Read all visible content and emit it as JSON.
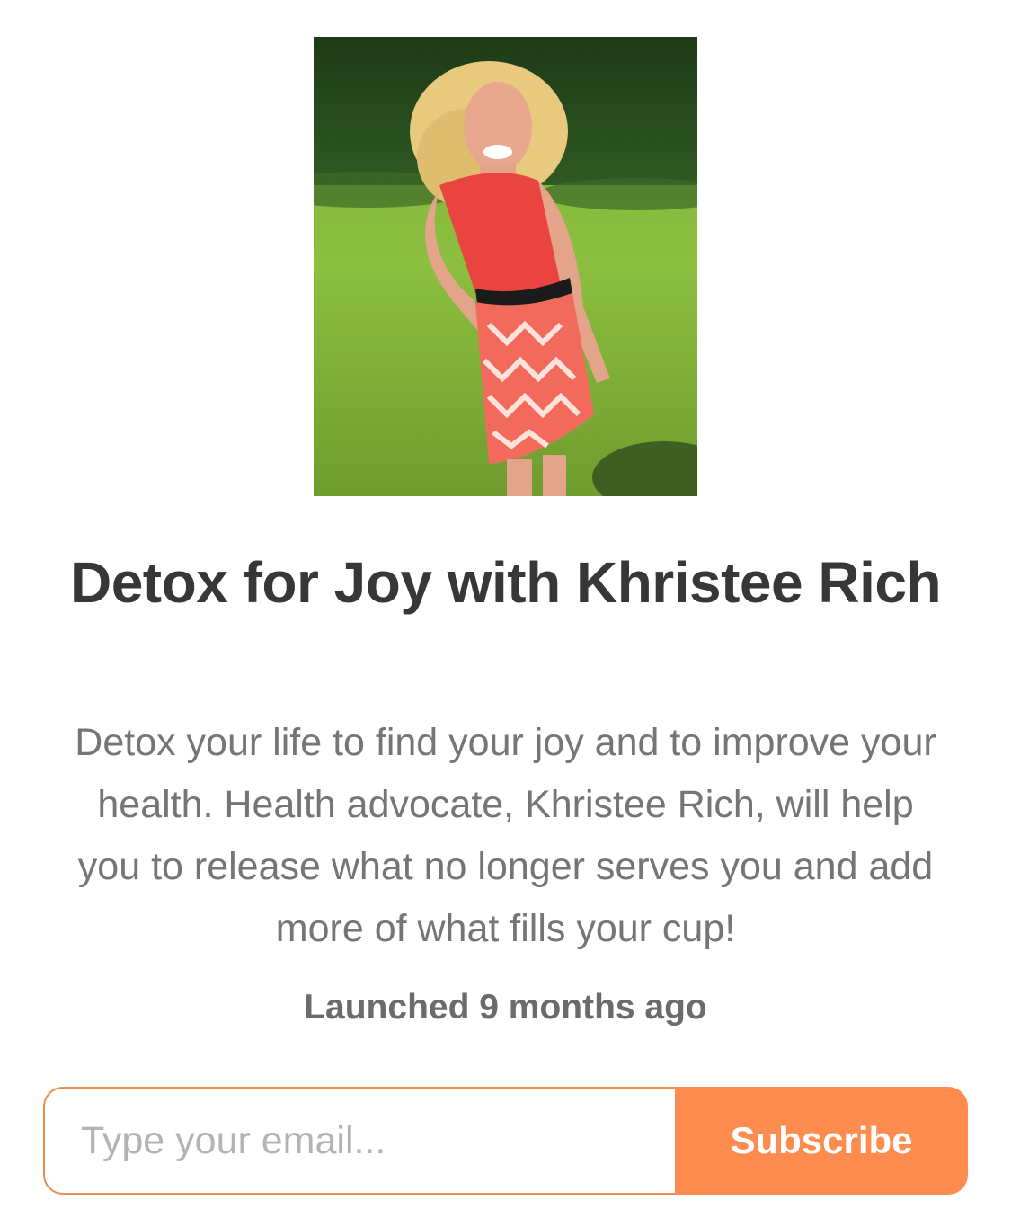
{
  "header": {
    "title": "Detox for Joy with Khristee Rich",
    "description": "Detox your life to find your joy and to improve your health. Health advocate, Khristee Rich, will help you to release what no longer serves you and add more of what fills your cup!",
    "launched": "Launched 9 months ago"
  },
  "subscribe": {
    "email_placeholder": "Type your email...",
    "email_value": "",
    "button_label": "Subscribe"
  },
  "colors": {
    "accent": "#fe8c4f",
    "input_border": "#f08c4d",
    "title_text": "#363737",
    "body_text": "#757575"
  }
}
